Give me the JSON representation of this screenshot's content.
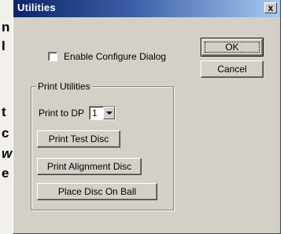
{
  "background": {
    "lines": [
      "n",
      "l",
      "t",
      "c",
      "w",
      "e"
    ]
  },
  "dialog": {
    "title": "Utilities",
    "close_symbol": "x",
    "enable_configure_label": "Enable Configure Dialog",
    "ok_label": "OK",
    "cancel_label": "Cancel",
    "print_utilities": {
      "group_title": "Print Utilities",
      "print_to_dp_label": "Print to DP",
      "print_to_dp_value": "1",
      "print_test_disc_label": "Print Test Disc",
      "print_alignment_disc_label": "Print Alignment Disc",
      "place_disc_on_ball_label": "Place Disc On Ball"
    }
  },
  "colors": {
    "titlebar_start": "#0a246a",
    "titlebar_end": "#a6caf0",
    "dialog_face": "#d4d0c8"
  }
}
